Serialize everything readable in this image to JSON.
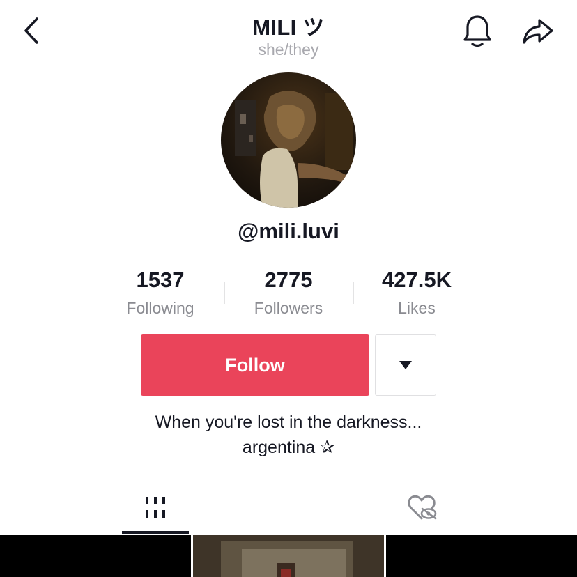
{
  "header": {
    "title": "MILI ツ",
    "pronouns": "she/they",
    "back_icon": "chevron-left-icon",
    "bell_icon": "bell-icon",
    "share_icon": "share-arrow-icon"
  },
  "profile": {
    "handle": "@mili.luvi",
    "stats": [
      {
        "value": "1537",
        "label": "Following"
      },
      {
        "value": "2775",
        "label": "Followers"
      },
      {
        "value": "427.5K",
        "label": "Likes"
      }
    ],
    "follow_label": "Follow",
    "more_icon": "triangle-down-icon",
    "bio_line1": "When you're lost in the darkness...",
    "bio_line2": "argentina ✰"
  },
  "tabs": [
    {
      "icon": "grid-videos-icon",
      "active": true
    },
    {
      "icon": "liked-hidden-heart-icon",
      "active": false
    }
  ],
  "colors": {
    "accent": "#ea445a",
    "text_primary": "#161823",
    "text_secondary": "#8a8b91"
  }
}
